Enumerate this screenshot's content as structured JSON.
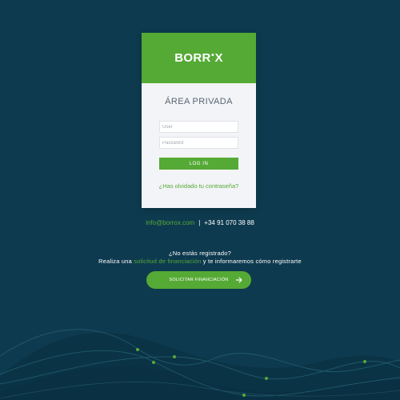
{
  "colors": {
    "background": "#0e3a4f",
    "accent": "#55aa35",
    "card": "#f2f4f7",
    "wave_line": "#1f5a6a",
    "dot": "#55aa35"
  },
  "card": {
    "logo": {
      "part1": "BORR",
      "dot": "•",
      "part2": "X"
    },
    "title": "ÁREA PRIVADA",
    "user_placeholder": "User",
    "password_placeholder": "Password",
    "login_label": "LOG IN",
    "forgot_label": "¿Has olvidado tu contraseña?"
  },
  "contact": {
    "email": "info@borrox.com",
    "separator": "|",
    "phone": "+34 91 070 38 88"
  },
  "register": {
    "question": "¿No estás registrado?",
    "line2_prefix": "Realiza una ",
    "line2_link": "solicitud de financiación",
    "line2_suffix": " y te informaremos cómo registrarte",
    "cta_label": "SOLICITAR FINANCIACIÓN",
    "cta_icon": "arrow-right-icon"
  }
}
